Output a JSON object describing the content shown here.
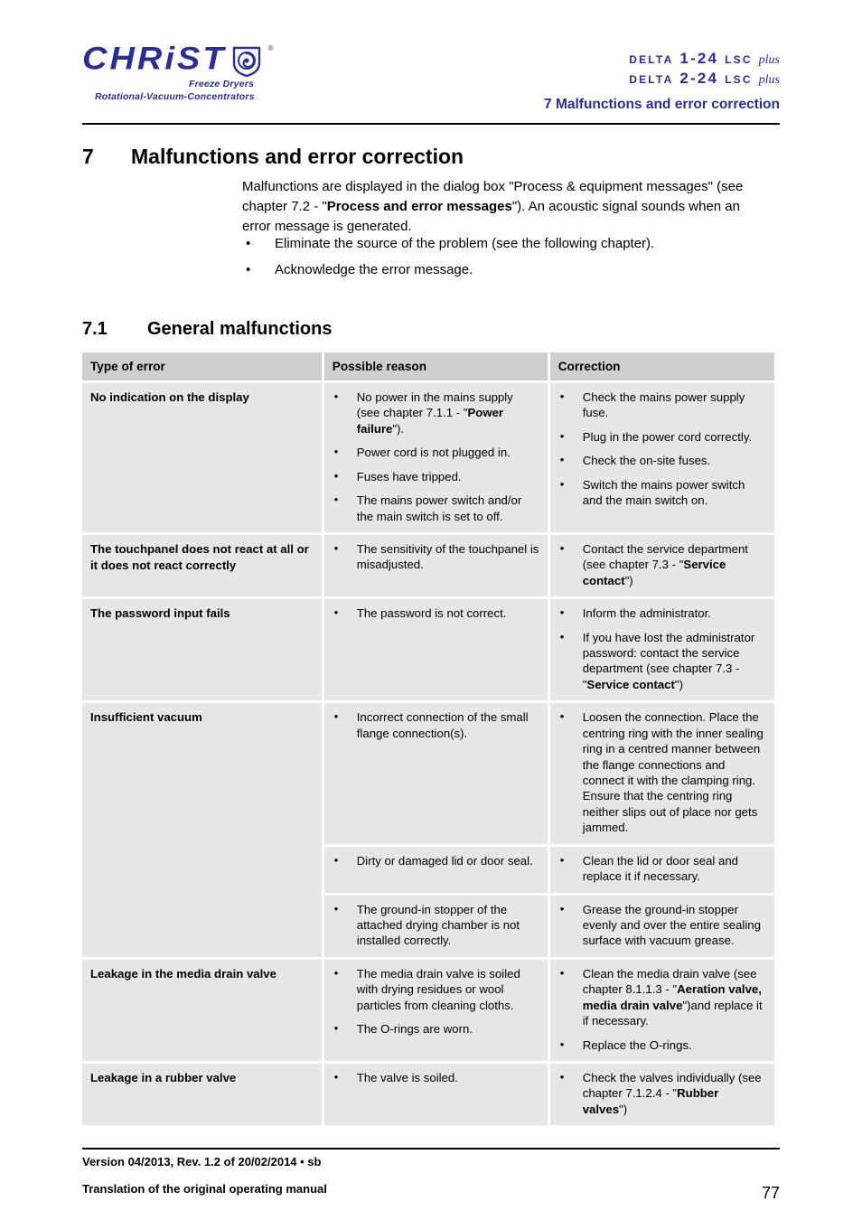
{
  "header": {
    "brand": {
      "wordmark": "CHRiST",
      "registered": "®",
      "sub_line_1": "Freeze Dryers",
      "sub_line_2": "Rotational-Vacuum-Concentrators",
      "color": "#2b2f8f"
    },
    "models": [
      {
        "name": "Delta 1-24 LSC",
        "suffix": "plus"
      },
      {
        "name": "Delta 2-24 LSC",
        "suffix": "plus"
      }
    ],
    "chapter_title": "7 Malfunctions and error correction"
  },
  "body": {
    "h1": {
      "number": "7",
      "text": "Malfunctions and error correction"
    },
    "intro_paragraph_parts": {
      "p1": "Malfunctions are displayed in the dialog box \"Process & equipment messages\" (see chapter 7.2 - \"",
      "bold": "Process and error messages",
      "p2": "\"). An acoustic signal sounds when an error message is generated."
    },
    "intro_bullets": [
      "Eliminate the source of the problem (see the following chapter).",
      "Acknowledge the error message."
    ],
    "h2": {
      "number": "7.1",
      "text": "General malfunctions"
    }
  },
  "table": {
    "headers": [
      "Type of error",
      "Possible reason",
      "Correction"
    ],
    "rows": [
      {
        "type": "No indication on the display",
        "reasons": [
          {
            "pre": "No power in the mains supply (see chapter 7.1.1 - \"",
            "bold": "Power failure",
            "post": "\")."
          },
          {
            "pre": "Power cord is not plugged in.",
            "bold": "",
            "post": ""
          },
          {
            "pre": "Fuses have tripped.",
            "bold": "",
            "post": ""
          },
          {
            "pre": "The mains power switch and/or the main switch is set to off.",
            "bold": "",
            "post": ""
          }
        ],
        "corrections": [
          {
            "pre": "Check the mains power supply fuse.",
            "bold": "",
            "post": ""
          },
          {
            "pre": "Plug in the power cord correctly.",
            "bold": "",
            "post": ""
          },
          {
            "pre": "Check the on-site fuses.",
            "bold": "",
            "post": ""
          },
          {
            "pre": "Switch the mains power switch and the main switch on.",
            "bold": "",
            "post": ""
          }
        ]
      },
      {
        "type": "The touchpanel does not react at all or it does not react correctly",
        "reasons": [
          {
            "pre": "The sensitivity of the touchpanel is misadjusted.",
            "bold": "",
            "post": ""
          }
        ],
        "corrections": [
          {
            "pre": "Contact the service department (see chapter 7.3 - \"",
            "bold": "Service contact",
            "post": "\")"
          }
        ]
      },
      {
        "type": "The password input fails",
        "reasons": [
          {
            "pre": "The password is not correct.",
            "bold": "",
            "post": ""
          }
        ],
        "corrections": [
          {
            "pre": "Inform the administrator.",
            "bold": "",
            "post": ""
          },
          {
            "pre": "If you have lost the administrator password: contact the service department (see chapter 7.3 - \"",
            "bold": "Service contact",
            "post": "\")"
          }
        ]
      },
      {
        "type": "Insufficient vacuum",
        "subrows": [
          {
            "reasons": [
              {
                "pre": "Incorrect connection of the small flange connection(s).",
                "bold": "",
                "post": ""
              }
            ],
            "corrections": [
              {
                "pre": "Loosen the connection. Place the centring ring with the inner sealing ring in a centred manner between the flange connections and connect it with the clamping ring. Ensure that the centring ring neither slips out of place nor gets jammed.",
                "bold": "",
                "post": ""
              }
            ]
          },
          {
            "reasons": [
              {
                "pre": "Dirty or damaged lid or door seal.",
                "bold": "",
                "post": ""
              }
            ],
            "corrections": [
              {
                "pre": "Clean the lid or door seal and replace it if necessary.",
                "bold": "",
                "post": ""
              }
            ]
          },
          {
            "reasons": [
              {
                "pre": "The ground-in stopper of the attached drying chamber is not installed correctly.",
                "bold": "",
                "post": ""
              }
            ],
            "corrections": [
              {
                "pre": "Grease the ground-in stopper evenly and over the entire sealing surface with vacuum grease.",
                "bold": "",
                "post": ""
              }
            ]
          }
        ]
      },
      {
        "type": "Leakage in the media drain valve",
        "reasons": [
          {
            "pre": "The media drain valve is soiled with drying residues or wool particles from cleaning cloths.",
            "bold": "",
            "post": ""
          },
          {
            "pre": "The O-rings are worn.",
            "bold": "",
            "post": ""
          }
        ],
        "corrections": [
          {
            "pre": "Clean the media drain valve (see chapter 8.1.1.3 - \"",
            "bold": "Aeration valve, media drain valve",
            "post": "\")and replace it if necessary."
          },
          {
            "pre": "Replace the O-rings.",
            "bold": "",
            "post": ""
          }
        ]
      },
      {
        "type": "Leakage in a rubber valve",
        "reasons": [
          {
            "pre": "The valve is soiled.",
            "bold": "",
            "post": ""
          }
        ],
        "corrections": [
          {
            "pre": "Check the valves individually (see chapter 7.1.2.4 - \"",
            "bold": "Rubber valves",
            "post": "\")"
          }
        ]
      }
    ]
  },
  "footer": {
    "version_line": "Version 04/2013, Rev. 1.2 of 20/02/2014 • sb",
    "translation_line": "Translation of the original operating manual",
    "page_number": "77"
  },
  "colors": {
    "brand_blue": "#2b2f8f",
    "table_header_bg": "#cfcfcf",
    "table_cell_bg": "#e6e6e6",
    "rule": "#000000"
  }
}
